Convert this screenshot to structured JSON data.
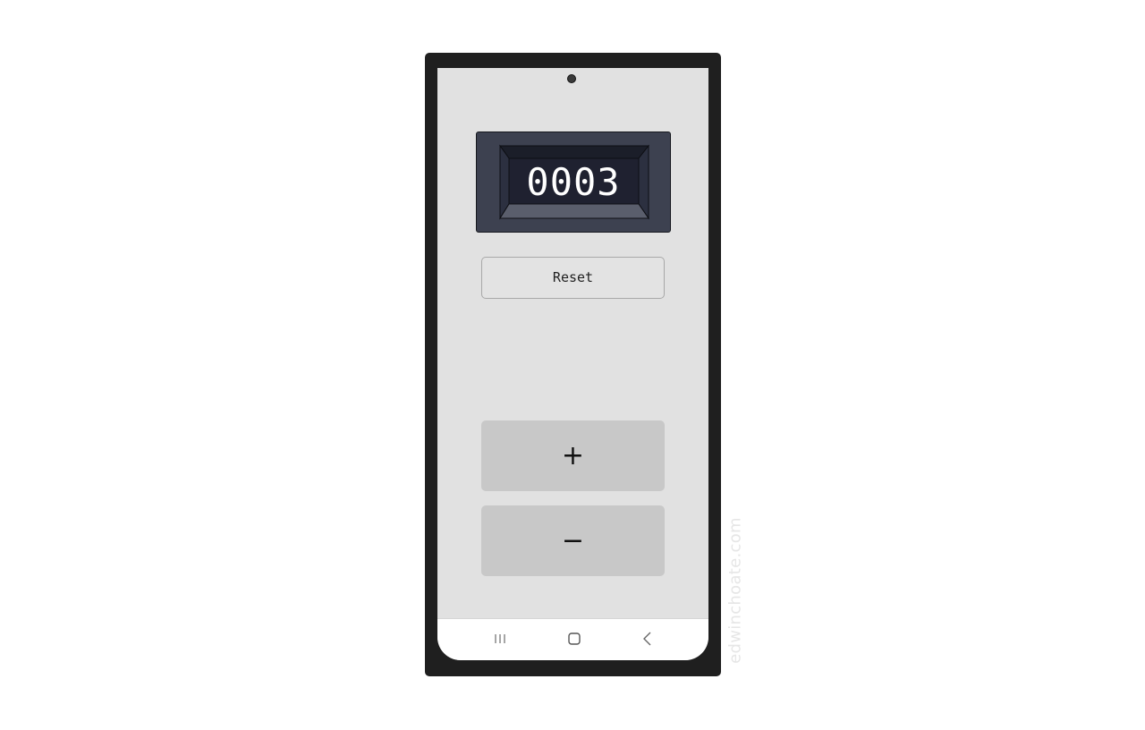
{
  "counter": {
    "value": "0003"
  },
  "buttons": {
    "reset_label": "Reset",
    "increment_label": "+",
    "decrement_label": "−"
  },
  "navbar": {
    "recents_icon": "recent-apps-icon",
    "home_icon": "home-icon",
    "back_icon": "back-icon"
  },
  "watermark": {
    "text": "edwinchoate.com"
  },
  "colors": {
    "phone_frame": "#1f1f1f",
    "screen_bg": "#e1e1e1",
    "counter_housing": "#3d4150",
    "counter_window": "#1f2130",
    "button_bg": "#c8c8c8"
  }
}
